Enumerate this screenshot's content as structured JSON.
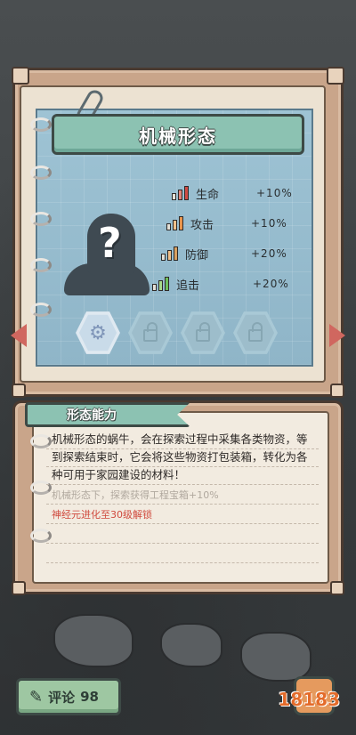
{
  "form_title": "机械形态",
  "stats": [
    {
      "name": "生命",
      "value": "+10%"
    },
    {
      "name": "攻击",
      "value": "+10%"
    },
    {
      "name": "防御",
      "value": "+20%"
    },
    {
      "name": "追击",
      "value": "+20%"
    }
  ],
  "ability": {
    "tab_label": "形态能力",
    "description": "机械形态的蜗牛，会在探索过程中采集各类物资，等到探索结束时，它会将这些物资打包装箱，转化为各种可用于家园建设的材料！",
    "bonus": "机械形态下，探索获得工程宝箱+10%",
    "unlock_requirement": "神经元进化至30级解锁"
  },
  "comment": {
    "label": "评论",
    "count": "98"
  },
  "watermark": "18183",
  "colors": {
    "accent_teal": "#8cc2b2",
    "warning_red": "#d04a3e",
    "blueprint": "#9ec3d4"
  }
}
